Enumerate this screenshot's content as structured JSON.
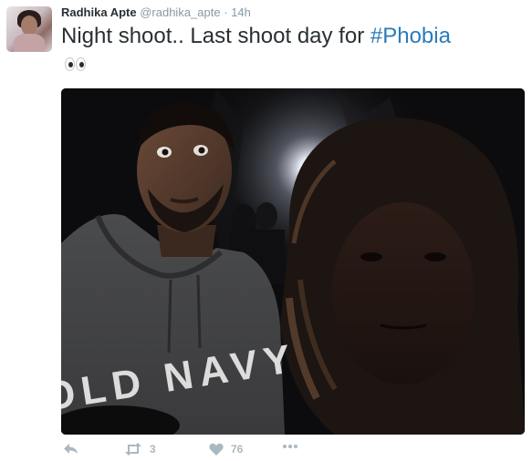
{
  "tweet": {
    "author_name": "Radhika Apte",
    "author_handle": "@radhika_apte",
    "separator": "·",
    "timestamp": "14h",
    "text_main": "Night shoot.. Last shoot day for ",
    "hashtag": "#Phobia",
    "emoji_icon": "eyes-emoji",
    "media_icon": "night-selfie-photo"
  },
  "actions": {
    "reply_icon": "reply-icon",
    "retweet_icon": "retweet-icon",
    "retweet_count": "3",
    "like_icon": "heart-icon",
    "like_count": "76",
    "more_icon": "more-icon"
  },
  "photo_text": {
    "hoodie_print": "OLD NAVY"
  },
  "colors": {
    "name_text": "#292f33",
    "meta_text": "#8899a6",
    "hashtag": "#2b7bb9",
    "action_icons": "#aab8c2"
  }
}
